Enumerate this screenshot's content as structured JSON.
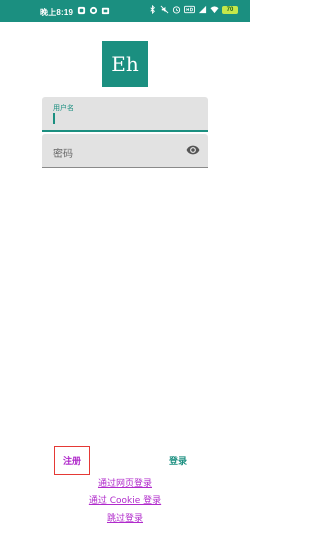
{
  "status_bar": {
    "time": "晚上8:19",
    "battery": "70",
    "colors": {
      "background": "#1b8f80",
      "battery": "#c4e84a"
    },
    "left_icons": [
      "notification-icon",
      "app-icon",
      "alarm-icon"
    ],
    "right_icons": [
      "bluetooth-icon",
      "mute-icon",
      "alarm-clock-icon",
      "hd-icon",
      "signal-icon",
      "wifi-icon",
      "battery-icon"
    ]
  },
  "logo": {
    "text": "Eh",
    "color": "#1b8f80"
  },
  "form": {
    "username": {
      "label": "用户名",
      "value": ""
    },
    "password": {
      "placeholder": "密码",
      "value": "",
      "toggle_icon": "eye-icon"
    }
  },
  "actions": {
    "register": "注册",
    "login": "登录"
  },
  "links": {
    "web_login": "通过网页登录",
    "cookie_login": "通过 Cookie 登录",
    "skip_login": "跳过登录"
  },
  "colors": {
    "primary": "#1b8f80",
    "link": "#b02acb",
    "highlight_border": "#e53935"
  }
}
